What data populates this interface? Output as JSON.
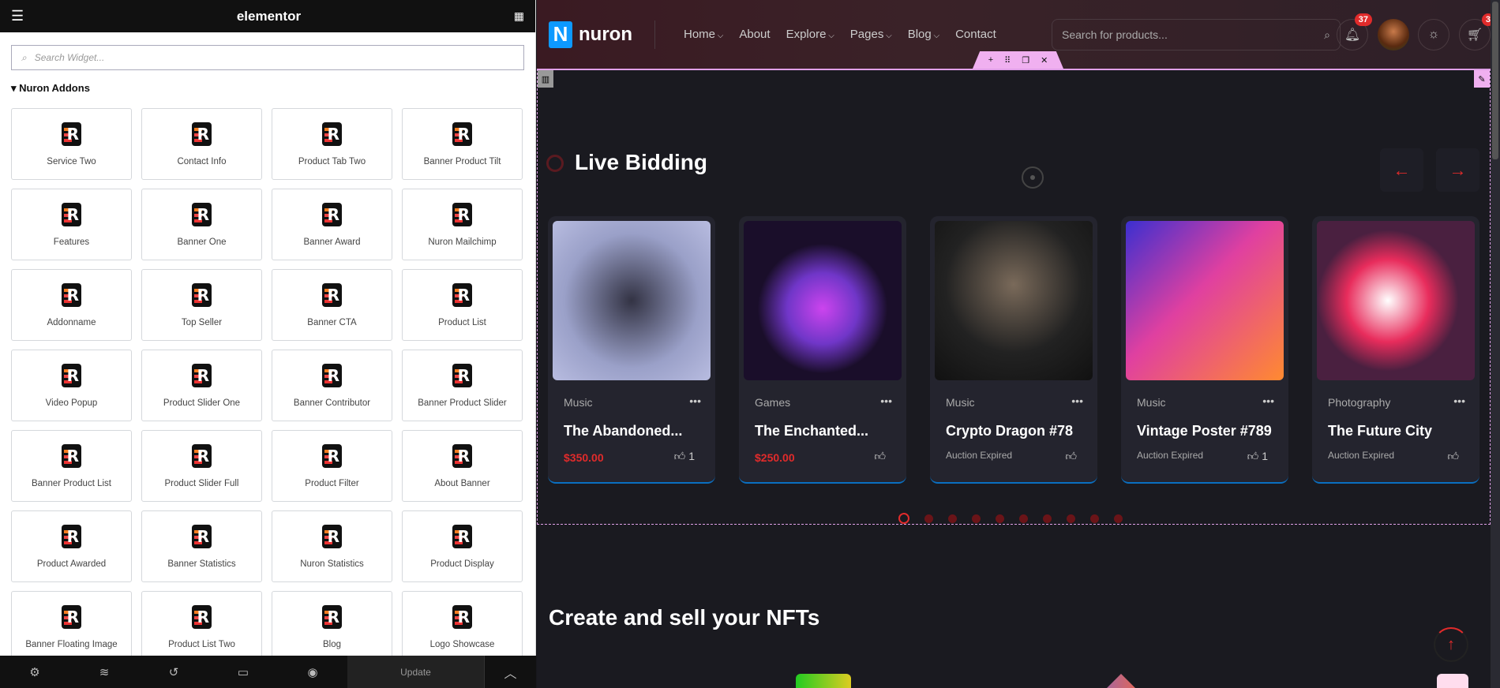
{
  "sidebar": {
    "brand": "elementor",
    "search_placeholder": "Search Widget...",
    "category": "Nuron Addons",
    "widgets": [
      "Service Two",
      "Contact Info",
      "Product Tab Two",
      "Banner Product Tilt",
      "Features",
      "Banner One",
      "Banner Award",
      "Nuron Mailchimp",
      "Addonname",
      "Top Seller",
      "Banner CTA",
      "Product List",
      "Video Popup",
      "Product Slider One",
      "Banner Contributor",
      "Banner Product Slider",
      "Banner Product List",
      "Product Slider Full",
      "Product Filter",
      "About Banner",
      "Product Awarded",
      "Banner Statistics",
      "Nuron Statistics",
      "Product Display",
      "Banner Floating Image",
      "Product List Two",
      "Blog",
      "Logo Showcase"
    ],
    "footer": {
      "update_label": "Update"
    }
  },
  "nav": {
    "logo_letter": "N",
    "logo_text": "nuron",
    "menu": [
      "Home",
      "About",
      "Explore",
      "Pages",
      "Blog",
      "Contact"
    ],
    "search_placeholder": "Search for products...",
    "notifications": "37",
    "cart": "3"
  },
  "section": {
    "title": "Live Bidding",
    "cards": [
      {
        "category": "Music",
        "title": "The Abandoned...",
        "price": "$350.00",
        "status": "",
        "likes": "1",
        "liked": true
      },
      {
        "category": "Games",
        "title": "The Enchanted...",
        "price": "$250.00",
        "status": "",
        "likes": "",
        "liked": false
      },
      {
        "category": "Music",
        "title": "Crypto Dragon #78",
        "price": "",
        "status": "Auction Expired",
        "likes": "",
        "liked": false
      },
      {
        "category": "Music",
        "title": "Vintage Poster #789",
        "price": "",
        "status": "Auction Expired",
        "likes": "1",
        "liked": true
      },
      {
        "category": "Photography",
        "title": "The Future City",
        "price": "",
        "status": "Auction Expired",
        "likes": "",
        "liked": false
      }
    ],
    "pagination": {
      "pages": 10,
      "active": 1
    }
  },
  "next_section": {
    "title": "Create and sell your NFTs"
  },
  "colors": {
    "accent": "#e12b2b",
    "logo": "#0d99ff",
    "editor_outline": "#e0a0e8"
  }
}
